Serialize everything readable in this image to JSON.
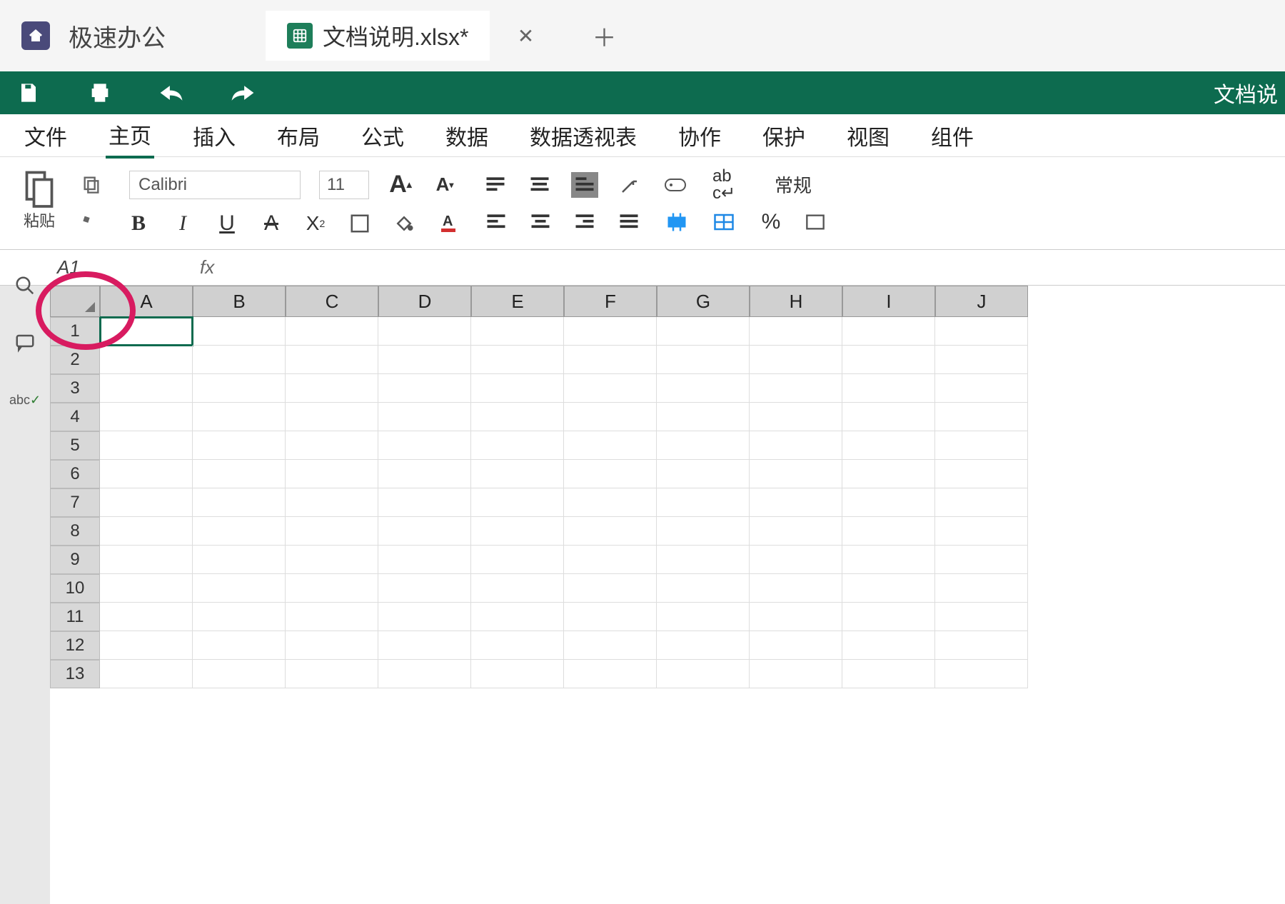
{
  "app": {
    "name": "极速办公"
  },
  "tab": {
    "filename": "文档说明.xlsx*"
  },
  "qat_right": "文档说",
  "menu": [
    "文件",
    "主页",
    "插入",
    "布局",
    "公式",
    "数据",
    "数据透视表",
    "协作",
    "保护",
    "视图",
    "组件"
  ],
  "menu_active_index": 1,
  "ribbon": {
    "paste_label": "粘贴",
    "font_name": "Calibri",
    "font_size": "11",
    "number_format": "常规",
    "percent": "%"
  },
  "namebox": "A1",
  "fx_label": "fx",
  "columns": [
    "A",
    "B",
    "C",
    "D",
    "E",
    "F",
    "G",
    "H",
    "I",
    "J"
  ],
  "rows": [
    1,
    2,
    3,
    4,
    5,
    6,
    7,
    8,
    9,
    10,
    11,
    12,
    13
  ],
  "selected_cell": "A1",
  "side_spell": "abc"
}
